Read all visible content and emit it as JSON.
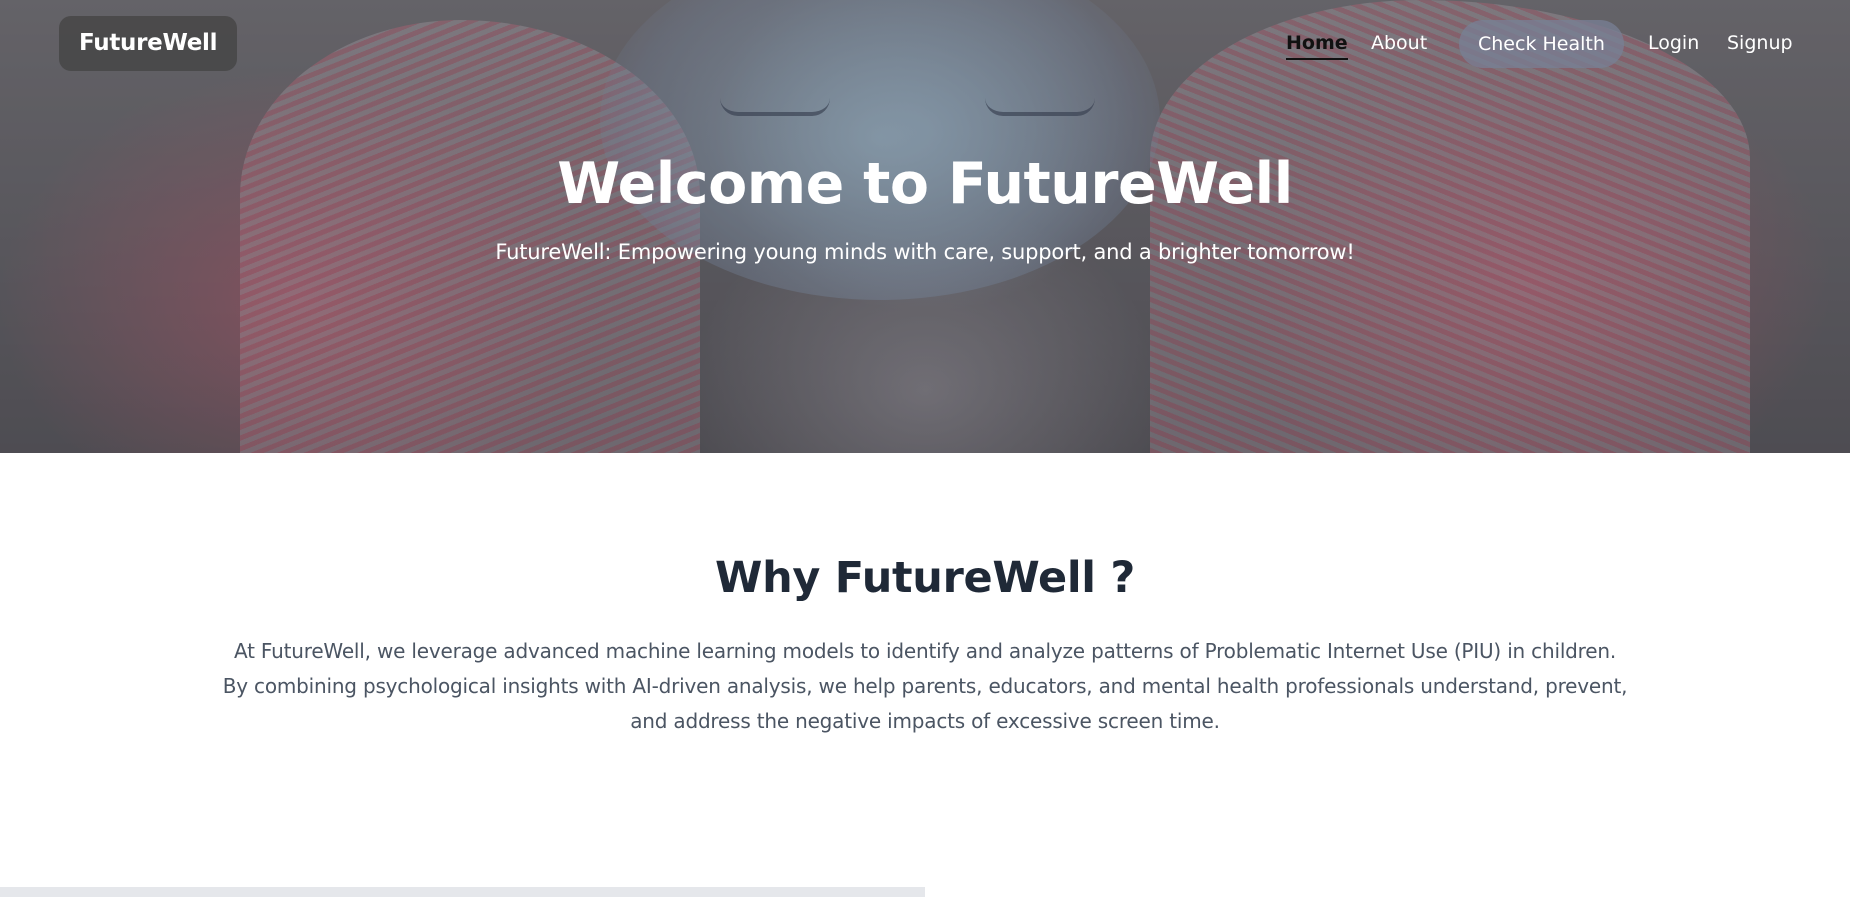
{
  "nav": {
    "brand": "FutureWell",
    "links": {
      "home": "Home",
      "about": "About",
      "check_health": "Check Health",
      "login": "Login",
      "signup": "Signup"
    },
    "active": "Home"
  },
  "hero": {
    "title": "Welcome to FutureWell",
    "subtitle": "FutureWell: Empowering young minds with care, support, and a brighter tomorrow!"
  },
  "why": {
    "title": "Why FutureWell ?",
    "lines": [
      "At FutureWell, we leverage advanced machine learning models to identify and analyze patterns of Problematic Internet Use (PIU) in children.",
      "By combining psychological insights with AI-driven analysis, we help parents, educators, and mental health professionals understand, prevent,",
      "and address the negative impacts of excessive screen time."
    ]
  },
  "colors": {
    "heading": "#1f2937",
    "body_text": "#4b5563",
    "active_link": "#111111",
    "check_health_bg": "#78809a"
  }
}
